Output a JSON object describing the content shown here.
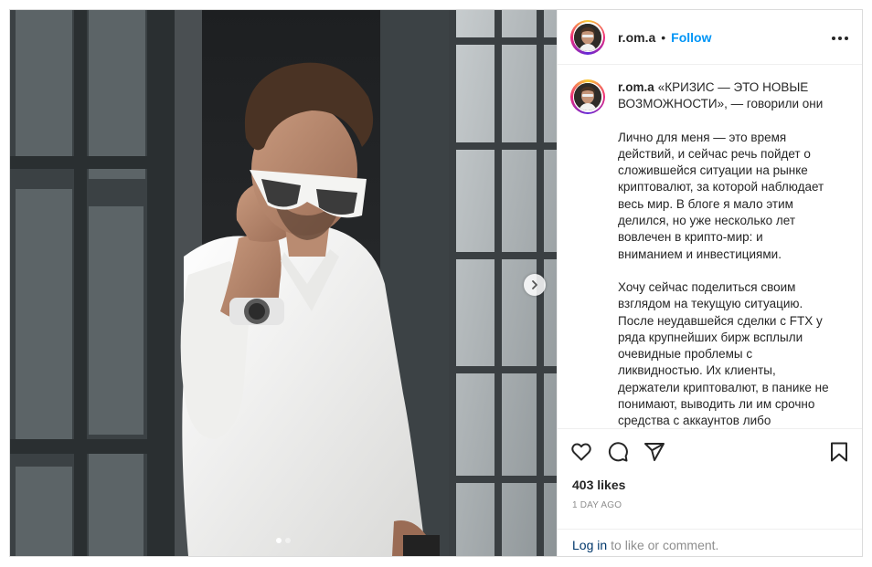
{
  "post": {
    "username": "r.om.a",
    "separator": "•",
    "follow_label": "Follow",
    "more_icon": "more-horizontal-icon",
    "media": {
      "slides_count": 2,
      "active_slide": 1,
      "next_icon": "chevron-right-icon"
    },
    "caption": {
      "username": "r.om.a",
      "lead": "«КРИЗИС — ЭТО НОВЫЕ ВОЗМОЖНОСТИ», — говорили они",
      "paragraph1": "Лично для меня — это время действий, и сейчас речь пойдет о сложившейся ситуации на рынке криптовалют, за которой наблюдает весь мир. В блоге я мало этим делился, но уже несколько лет вовлечен в крипто-мир: и вниманием и инвестициями.",
      "paragraph2": "Хочу сейчас поделиться своим взглядом на текущую ситуацию. После неудавшейся сделки с FTX у ряда крупнейших бирж всплыли очевидные проблемы с ликвидностью. Их клиенты, держатели криптовалют, в панике не понимают, выводить ли им срочно средства с аккаунтов либо"
    },
    "actions": {
      "like_icon": "heart-icon",
      "comment_icon": "comment-icon",
      "share_icon": "send-icon",
      "save_icon": "bookmark-icon"
    },
    "likes": "403 likes",
    "time": "1 DAY AGO",
    "comment_bar": {
      "login_label": "Log in",
      "rest": "to like or comment."
    },
    "colors": {
      "follow_blue": "#0095f6",
      "link_dark": "#00376b",
      "muted": "#8e8e8e",
      "text": "#262626"
    }
  }
}
